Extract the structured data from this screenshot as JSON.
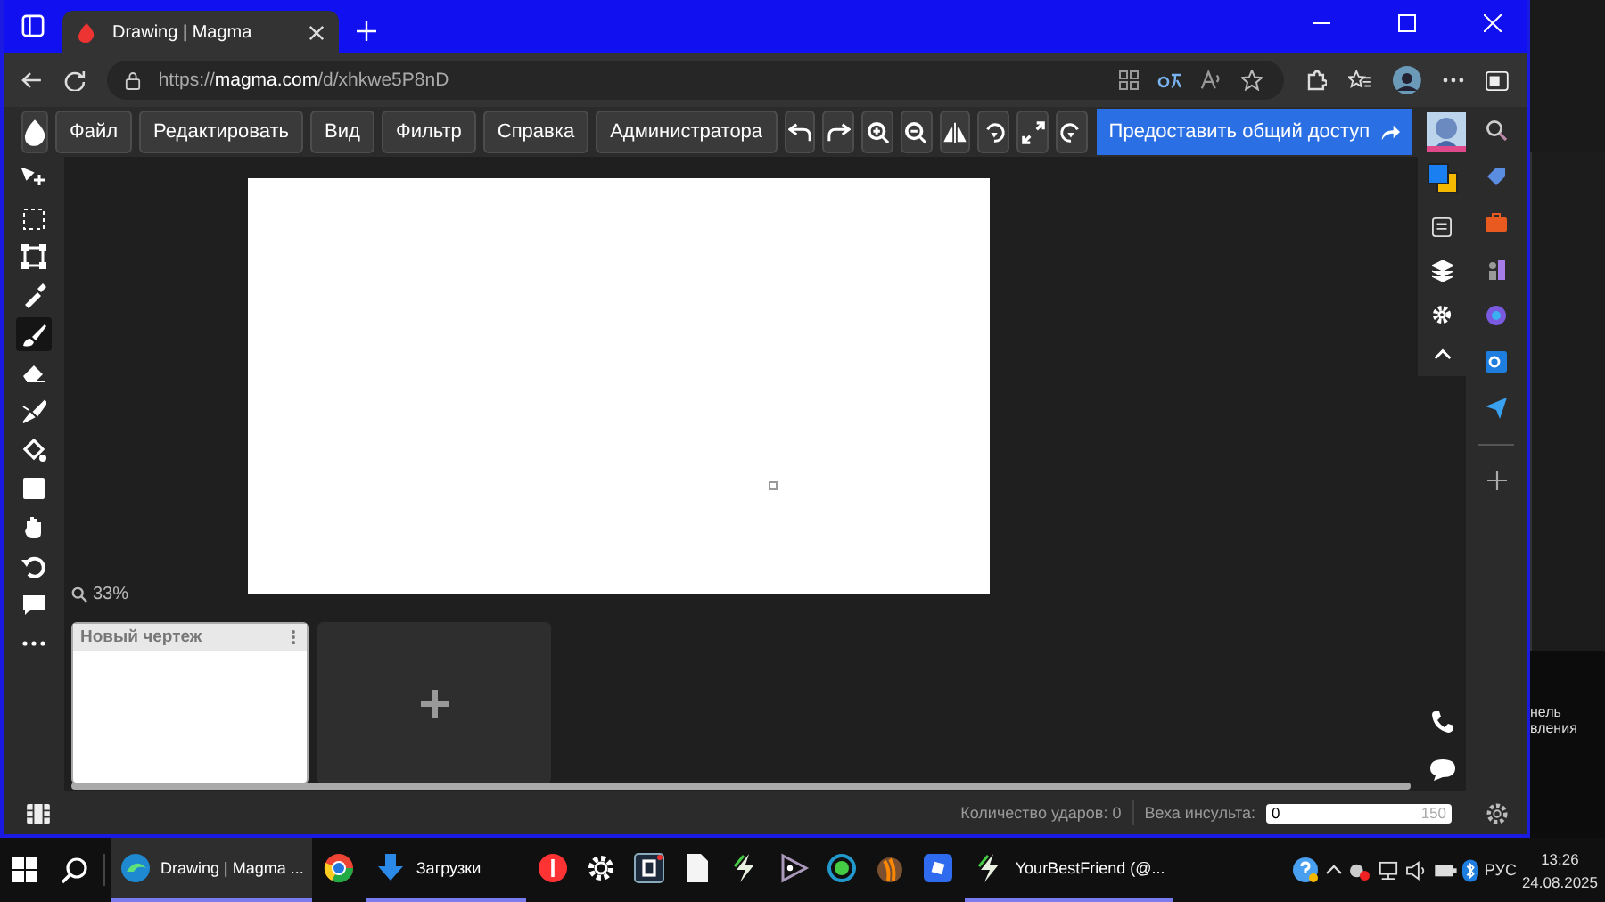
{
  "browser": {
    "tab_title": "Drawing | Magma",
    "url": "https://**magma.com**/d/xhkwe5P8nD"
  },
  "menu": [
    "Файл",
    "Редактировать",
    "Вид",
    "Фильтр",
    "Справка",
    "Администратора"
  ],
  "actions": [
    {
      "kind": "undo"
    },
    {
      "kind": "redo"
    },
    {
      "kind": "zoom-in"
    },
    {
      "kind": "zoom-out"
    },
    {
      "kind": "flip"
    },
    {
      "kind": "rotate-left"
    },
    {
      "kind": "fullscreen"
    },
    {
      "kind": "rotate-right"
    }
  ],
  "share_button": "Предоставить общий доступ",
  "tools": [
    {
      "kind": "move",
      "selected": false
    },
    {
      "kind": "select",
      "selected": false
    },
    {
      "kind": "transform",
      "selected": false
    },
    {
      "kind": "eyedropper",
      "selected": false
    },
    {
      "kind": "brush",
      "selected": true
    },
    {
      "kind": "eraser",
      "selected": false
    },
    {
      "kind": "smudge",
      "selected": false
    },
    {
      "kind": "fill",
      "selected": false
    },
    {
      "kind": "rect",
      "selected": false
    },
    {
      "kind": "hand",
      "selected": false
    },
    {
      "kind": "rotate",
      "selected": false
    },
    {
      "kind": "comment",
      "selected": false
    },
    {
      "kind": "more",
      "selected": false
    }
  ],
  "zoom": "33%",
  "drawings": [
    {
      "title": "Новый чертеж",
      "selected": true
    }
  ],
  "status": {
    "strokes": "Количество ударов: 0",
    "milestone_label": "Веха инсульта:",
    "milestone_value": "0",
    "milestone_max": "150"
  },
  "taskbar": {
    "items": [
      {
        "kind": "edge",
        "label": "Drawing | Magma ...",
        "selected": true,
        "open": true
      },
      {
        "kind": "chrome",
        "selected": false,
        "open": false
      },
      {
        "kind": "download",
        "label": "Загрузки",
        "selected": false,
        "open": true
      },
      {
        "kind": "yandex",
        "selected": false,
        "open": false
      },
      {
        "kind": "gear",
        "selected": false,
        "open": false
      },
      {
        "kind": "r-app",
        "selected": false,
        "open": false
      },
      {
        "kind": "file",
        "selected": false,
        "open": false
      },
      {
        "kind": "bolt",
        "selected": false,
        "open": false
      },
      {
        "kind": "play",
        "selected": false,
        "open": false
      },
      {
        "kind": "ring",
        "selected": false,
        "open": false
      },
      {
        "kind": "fruit",
        "selected": false,
        "open": false
      },
      {
        "kind": "square",
        "selected": false,
        "open": false
      },
      {
        "kind": "bolt",
        "label": "YourBestFriend (@...",
        "selected": false,
        "open": true
      }
    ],
    "lang": "РУС",
    "time": "13:26",
    "date": "24.08.2025"
  },
  "background_window": {
    "texts": [
      "нель",
      "вления"
    ]
  }
}
